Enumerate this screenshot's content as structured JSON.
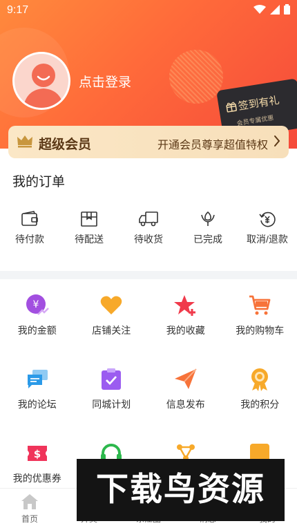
{
  "status_bar": {
    "time": "9:17",
    "icons": [
      "wifi-icon",
      "signal-icon",
      "battery-icon"
    ]
  },
  "profile": {
    "login_text": "点击登录"
  },
  "checkin_card": {
    "title": "签到有礼",
    "subtitle": "会员专属优惠"
  },
  "member": {
    "title": "超级会员",
    "promo": "开通会员尊享超值特权"
  },
  "orders": {
    "title": "我的订单",
    "items": [
      {
        "label": "待付款",
        "icon": "wallet-icon"
      },
      {
        "label": "待配送",
        "icon": "package-icon"
      },
      {
        "label": "待收货",
        "icon": "truck-icon"
      },
      {
        "label": "已完成",
        "icon": "flower-icon"
      },
      {
        "label": "取消/退款",
        "icon": "refund-icon"
      }
    ]
  },
  "services": [
    {
      "label": "我的金额",
      "icon": "money-icon",
      "color": "#a24fe0"
    },
    {
      "label": "店铺关注",
      "icon": "heart-icon",
      "color": "#f7a92a"
    },
    {
      "label": "我的收藏",
      "icon": "star-icon",
      "color": "#f03a4b"
    },
    {
      "label": "我的购物车",
      "icon": "cart-icon",
      "color": "#f7733a"
    },
    {
      "label": "我的论坛",
      "icon": "chat-icon",
      "color": "#2b9ae8"
    },
    {
      "label": "同城计划",
      "icon": "checklist-icon",
      "color": "#9b5cf0"
    },
    {
      "label": "信息发布",
      "icon": "paper-plane-icon",
      "color": "#f7733a"
    },
    {
      "label": "我的积分",
      "icon": "medal-icon",
      "color": "#f7a92a"
    },
    {
      "label": "我的优惠券",
      "icon": "coupon-icon",
      "color": "#f0345a"
    },
    {
      "label": "",
      "icon": "headset-icon",
      "color": "#2db84d"
    },
    {
      "label": "",
      "icon": "network-icon",
      "color": "#f7a92a"
    },
    {
      "label": "",
      "icon": "square-icon",
      "color": "#f7a92a"
    }
  ],
  "bottom_nav": [
    {
      "label": "首页",
      "icon": "home-icon"
    },
    {
      "label": "开奖",
      "icon": "lottery-icon"
    },
    {
      "label": "东江圈",
      "icon": "circle-icon"
    },
    {
      "label": "消息",
      "icon": "message-icon"
    },
    {
      "label": "我的",
      "icon": "profile-icon"
    }
  ],
  "watermark": {
    "text": "下载鸟资源"
  },
  "colors": {
    "header_start": "#ff8a3c",
    "header_end": "#f54a3a",
    "member_bg": "#fbe7c6",
    "member_text": "#5b3816"
  }
}
